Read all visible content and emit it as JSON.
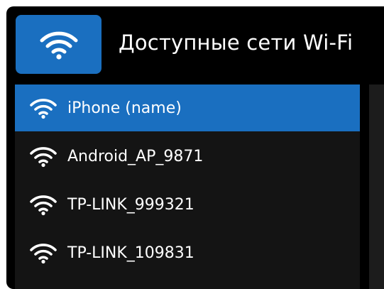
{
  "header": {
    "title": "Доступные сети Wi-Fi",
    "icon": "wifi-icon"
  },
  "networks": [
    {
      "ssid": "iPhone (name)",
      "selected": true,
      "icon": "wifi-icon"
    },
    {
      "ssid": "Android_AP_9871",
      "selected": false,
      "icon": "wifi-icon"
    },
    {
      "ssid": "TP-LINK_999321",
      "selected": false,
      "icon": "wifi-icon"
    },
    {
      "ssid": "TP-LINK_109831",
      "selected": false,
      "icon": "wifi-icon"
    }
  ],
  "colors": {
    "accent": "#1a6fc0",
    "background": "#000000",
    "list_background": "#141414",
    "text": "#ffffff"
  }
}
